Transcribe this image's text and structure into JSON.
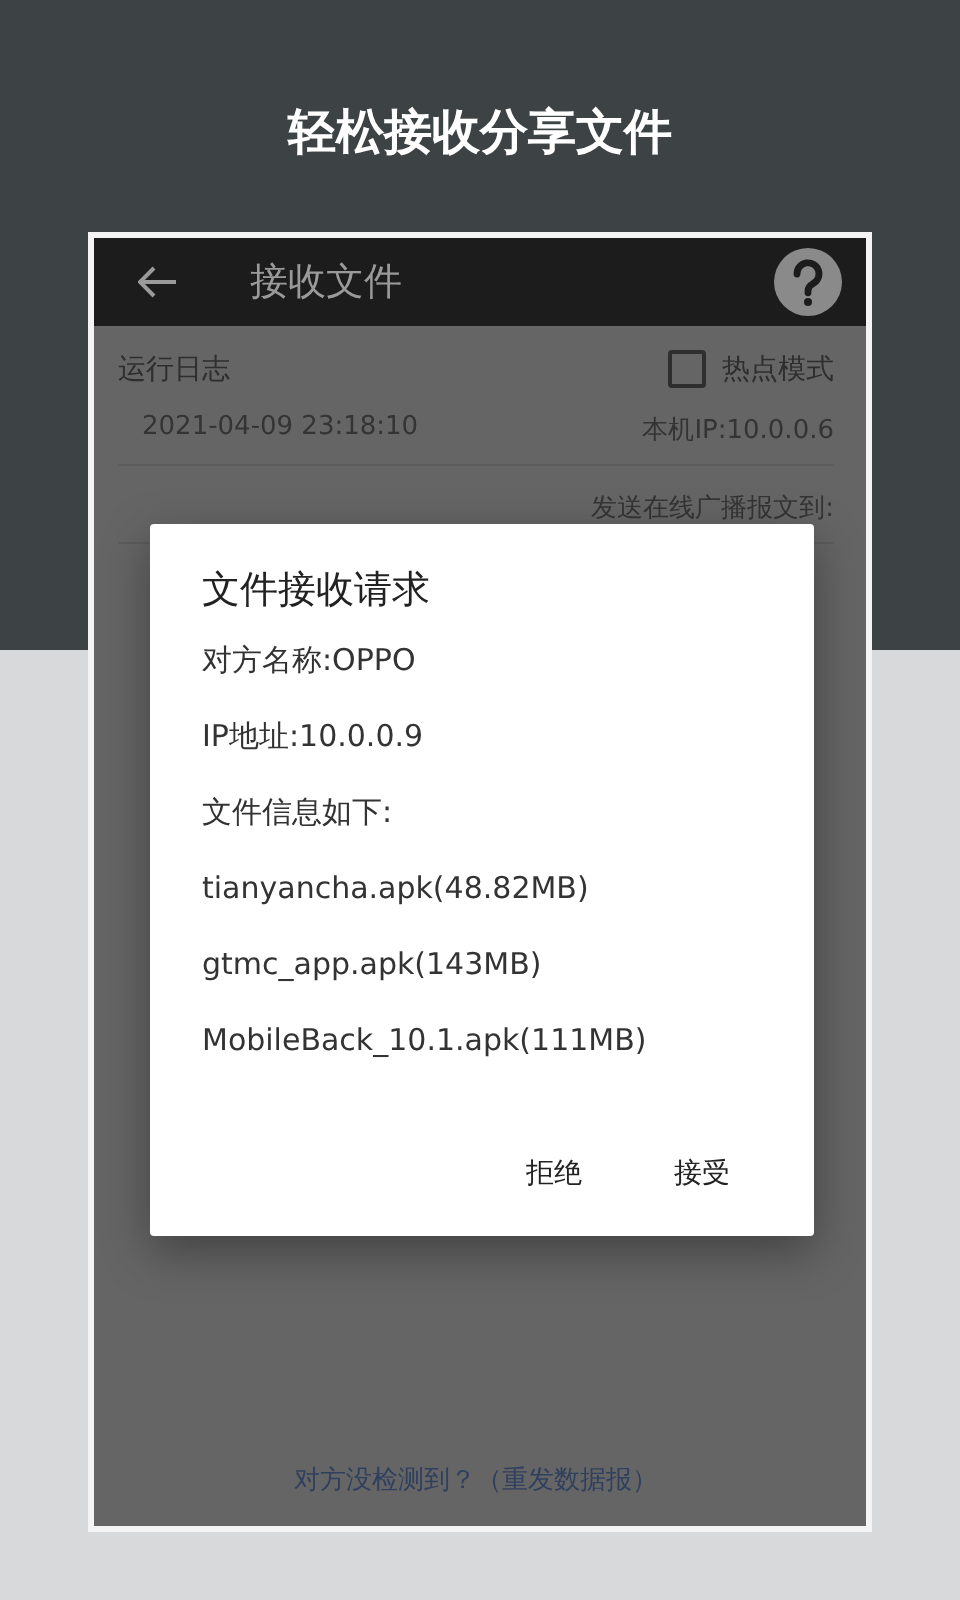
{
  "headline": "轻松接收分享文件",
  "app_bar": {
    "title": "接收文件"
  },
  "log": {
    "label": "运行日志",
    "hotspot": {
      "label": "热点模式",
      "checked": false
    },
    "rows": [
      {
        "time": "2021-04-09 23:18:10",
        "message": "本机IP:10.0.0.6"
      },
      {
        "time": "",
        "message": "发送在线广播报文到:"
      }
    ]
  },
  "dialog": {
    "title": "文件接收请求",
    "lines": [
      "对方名称:OPPO",
      "IP地址:10.0.0.9",
      "文件信息如下:",
      "tianyancha.apk(48.82MB)",
      "gtmc_app.apk(143MB)",
      "MobileBack_10.1.apk(111MB)"
    ],
    "buttons": [
      "拒绝",
      "接受"
    ]
  },
  "footer_link": "对方没检测到？（重发数据报）"
}
